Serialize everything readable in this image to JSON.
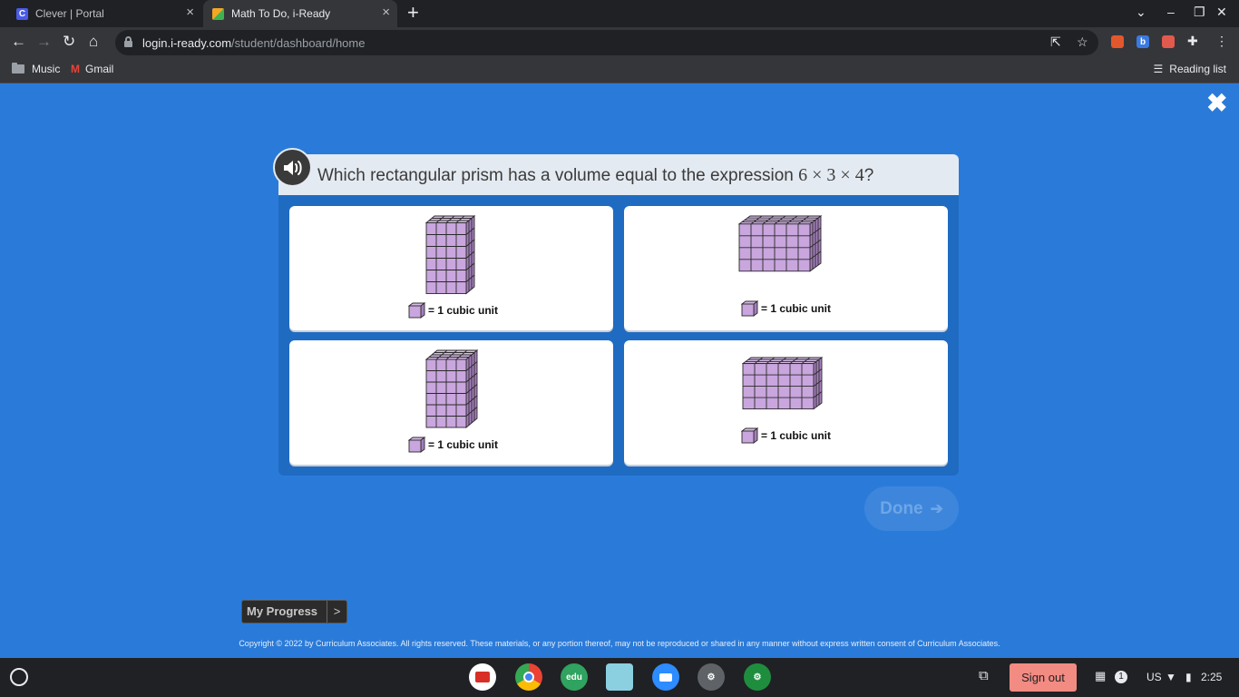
{
  "browser": {
    "tabs": [
      {
        "title": "Clever | Portal",
        "icon": "C"
      },
      {
        "title": "Math To Do, i-Ready"
      }
    ],
    "url_host": "login.i-ready.com",
    "url_path": "/student/dashboard/home",
    "bookmarks": [
      {
        "label": "Music"
      },
      {
        "label": "Gmail"
      }
    ],
    "reading_list_label": "Reading list",
    "extension_badges": [
      "b"
    ]
  },
  "question": {
    "text": "Which rectangular prism has a volume equal to the expression ",
    "math": "6 × 3 × 4",
    "end": "?"
  },
  "answer_choices": [
    {
      "legend": "= 1 cubic unit"
    },
    {
      "legend": "= 1 cubic unit"
    },
    {
      "legend": "= 1 cubic unit"
    },
    {
      "legend": "= 1 cubic unit"
    }
  ],
  "done_label": "Done",
  "done_arrow": "➔",
  "progress": {
    "label": "My Progress",
    "chevron": ">"
  },
  "copyright": "Copyright © 2022 by Curriculum Associates. All rights reserved. These materials, or any portion thereof, may not be reproduced or shared in any manner without express written consent of Curriculum Associates.",
  "shelf": {
    "app_labels": [
      "edu"
    ],
    "signout_label": "Sign out",
    "notification_count": "1",
    "keyboard": "US",
    "time": "2:25"
  },
  "colors": {
    "page_bg": "#2a7bd9",
    "cube_front": "#c9a6de",
    "cube_top": "#d9bde9",
    "cube_side": "#a57fbd",
    "cube_edge": "#2a2a2a",
    "sign_out_bg": "#f28b82"
  },
  "icons": [
    "clever-icon",
    "iready-icon",
    "back-arrow-icon",
    "forward-arrow-icon",
    "reload-icon",
    "home-icon",
    "lock-icon",
    "share-icon",
    "star-icon",
    "extensions-icon",
    "more-icon",
    "folder-icon",
    "gmail-icon",
    "reading-list-icon",
    "close-icon",
    "speaker-icon",
    "launcher-icon",
    "wifi-icon",
    "battery-icon"
  ]
}
